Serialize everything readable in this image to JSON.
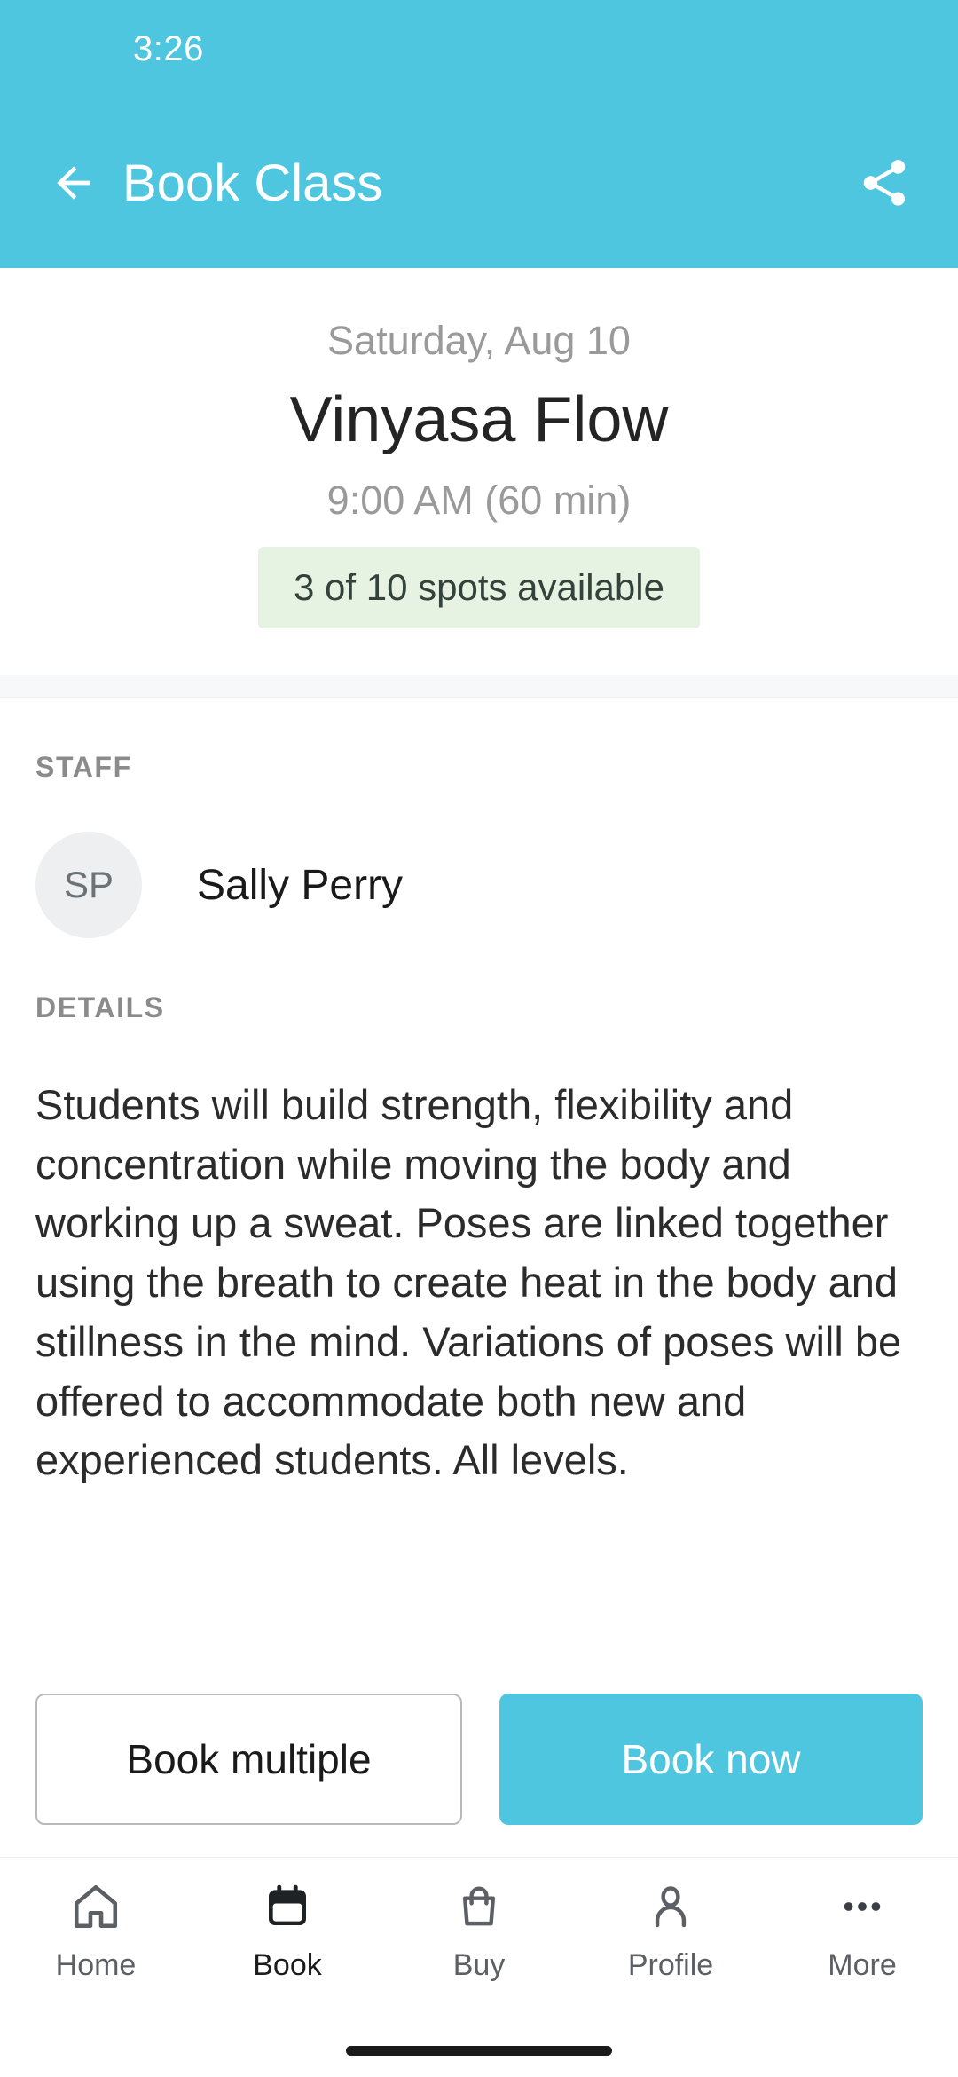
{
  "status_bar": {
    "time": "3:26"
  },
  "app_bar": {
    "title": "Book Class",
    "back_icon": "arrow-left-icon",
    "share_icon": "share-icon"
  },
  "class_header": {
    "date": "Saturday, Aug 10",
    "name": "Vinyasa Flow",
    "time": "9:00 AM (60 min)",
    "availability": "3 of 10 spots available"
  },
  "staff_section": {
    "label": "STAFF",
    "initials": "SP",
    "name": "Sally Perry"
  },
  "details_section": {
    "label": "DETAILS",
    "text": "Students will build strength, flexibility and concentration while moving the body and working up a sweat. Poses are linked together using the breath to create heat in the body and stillness in the mind. Variations of poses will be offered to accommodate both new and experienced students. All levels."
  },
  "actions": {
    "secondary_label": "Book multiple",
    "primary_label": "Book now"
  },
  "bottom_nav": {
    "items": [
      {
        "label": "Home",
        "icon": "home-icon",
        "active": false
      },
      {
        "label": "Book",
        "icon": "calendar-icon",
        "active": true
      },
      {
        "label": "Buy",
        "icon": "shopping-bag-icon",
        "active": false
      },
      {
        "label": "Profile",
        "icon": "person-icon",
        "active": false
      },
      {
        "label": "More",
        "icon": "more-dots-icon",
        "active": false
      }
    ]
  },
  "colors": {
    "accent": "#4FC6E0",
    "badge_background": "#E6F2E2",
    "badge_text": "#33423A",
    "muted_text": "#9A9A9A",
    "primary_text": "#242424",
    "avatar_background": "#EDEFF1"
  }
}
